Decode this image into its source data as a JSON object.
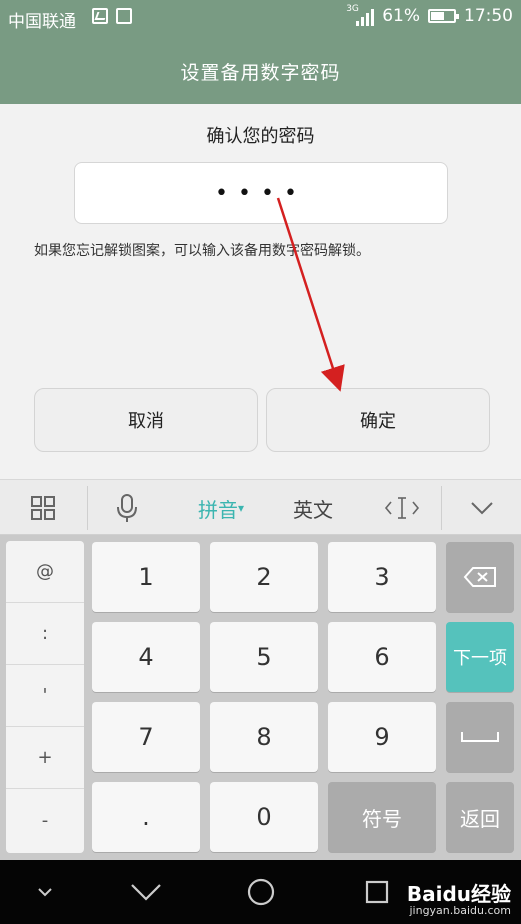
{
  "status_bar": {
    "carrier": "中国联通",
    "network": "3G",
    "battery": "61%",
    "battery_level": 0.61,
    "time": "17:50"
  },
  "header": {
    "title": "设置备用数字密码"
  },
  "dialog": {
    "prompt": "确认您的密码",
    "password_mask": "••••",
    "hint": "如果您忘记解锁图案，可以输入该备用数字密码解锁。",
    "cancel_label": "取消",
    "ok_label": "确定"
  },
  "keyboard_toolbar": {
    "pinyin_label": "拼音",
    "english_label": "英文"
  },
  "keyboard": {
    "side_keys": [
      "@",
      ":",
      "'",
      "+",
      "-"
    ],
    "digits": [
      "1",
      "2",
      "3",
      "4",
      "5",
      "6",
      "7",
      "8",
      "9",
      "0"
    ],
    "dot": ".",
    "symbols_label": "符号",
    "next_label": "下一项",
    "back_label": "返回"
  },
  "watermark": {
    "brand": "Baidu经验",
    "url": "jingyan.baidu.com"
  },
  "colors": {
    "header_bg": "#799b83",
    "accent_teal": "#55c2bc",
    "arrow_red": "#d42020"
  }
}
